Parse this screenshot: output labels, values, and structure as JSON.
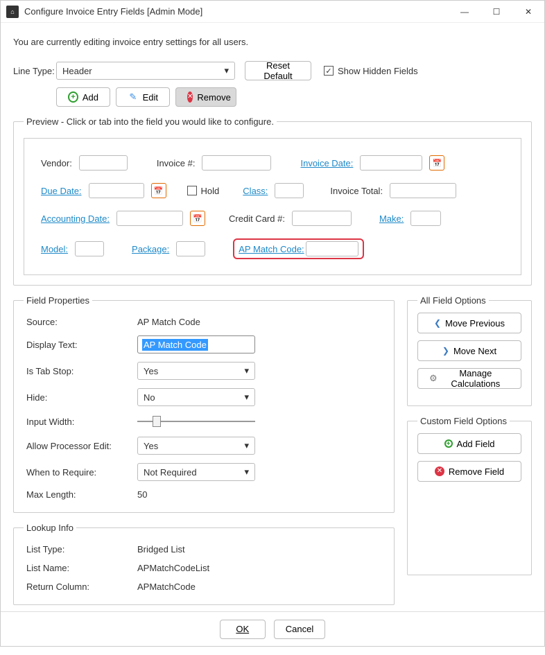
{
  "window": {
    "title": "Configure Invoice Entry Fields [Admin Mode]"
  },
  "subtitle": "You are currently editing invoice entry settings for all users.",
  "line_type": {
    "label": "Line Type:",
    "value": "Header"
  },
  "reset_default_label": "Reset Default",
  "show_hidden": {
    "label": "Show Hidden Fields",
    "checked": true
  },
  "toolbar": {
    "add": "Add",
    "edit": "Edit",
    "remove": "Remove"
  },
  "preview": {
    "legend": "Preview - Click or tab into the field you would like to configure.",
    "fields": {
      "vendor": "Vendor:",
      "invoice_no": "Invoice #:",
      "invoice_date": "Invoice Date:",
      "due_date": "Due Date:",
      "hold": "Hold",
      "class": "Class:",
      "invoice_total": "Invoice Total:",
      "accounting_date": "Accounting Date:",
      "credit_card_no": "Credit Card #:",
      "make": "Make:",
      "model": "Model:",
      "package": "Package:",
      "ap_match_code": "AP Match Code:"
    }
  },
  "field_properties": {
    "legend": "Field Properties",
    "source_label": "Source:",
    "source_value": "AP Match Code",
    "display_text_label": "Display Text:",
    "display_text_value": "AP Match Code",
    "is_tab_stop_label": "Is Tab Stop:",
    "is_tab_stop_value": "Yes",
    "hide_label": "Hide:",
    "hide_value": "No",
    "input_width_label": "Input Width:",
    "allow_processor_edit_label": "Allow Processor Edit:",
    "allow_processor_edit_value": "Yes",
    "when_to_require_label": "When to Require:",
    "when_to_require_value": "Not Required",
    "max_length_label": "Max Length:",
    "max_length_value": "50"
  },
  "lookup_info": {
    "legend": "Lookup Info",
    "list_type_label": "List Type:",
    "list_type_value": "Bridged List",
    "list_name_label": "List Name:",
    "list_name_value": "APMatchCodeList",
    "return_column_label": "Return Column:",
    "return_column_value": "APMatchCode"
  },
  "all_field_options": {
    "legend": "All Field Options",
    "move_previous": "Move Previous",
    "move_next": "Move Next",
    "manage_calculations": "Manage Calculations"
  },
  "custom_field_options": {
    "legend": "Custom Field Options",
    "add_field": "Add Field",
    "remove_field": "Remove Field"
  },
  "footer": {
    "ok": "OK",
    "cancel": "Cancel"
  }
}
